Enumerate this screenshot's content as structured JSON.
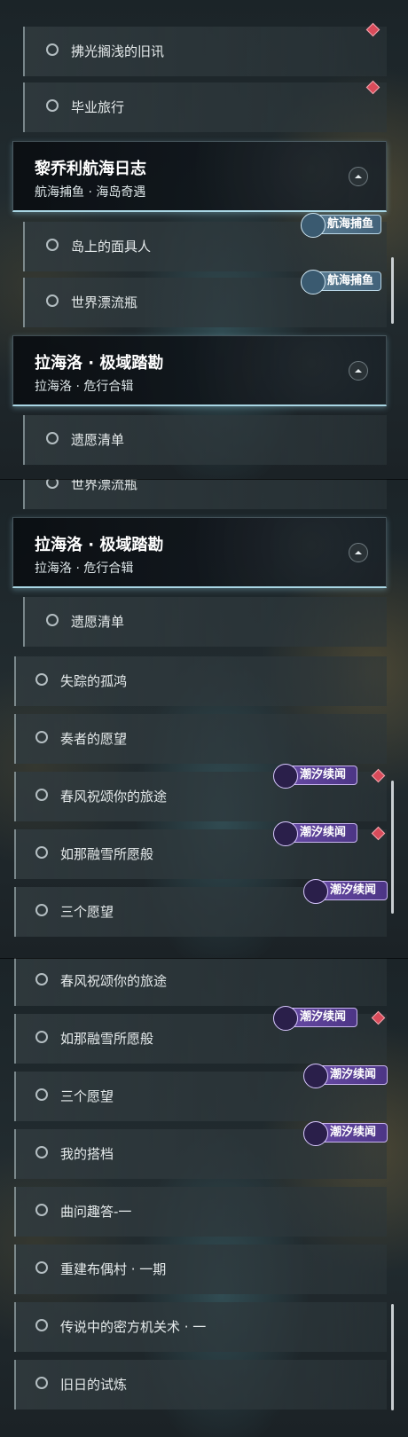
{
  "panel1": {
    "rows_top": [
      {
        "label": "拂光搁浅的旧讯",
        "flag": true
      },
      {
        "label": "毕业旅行",
        "flag": true
      }
    ],
    "group_a": {
      "title": "黎乔利航海日志",
      "subtitle": "航海捕鱼 · 海岛奇遇"
    },
    "rows_mid": [
      {
        "label": "岛上的面具人",
        "badge": "航海捕鱼"
      },
      {
        "label": "世界漂流瓶",
        "badge": "航海捕鱼"
      }
    ],
    "group_b": {
      "title": "拉海洛 · 极域踏勘",
      "subtitle": "拉海洛 · 危行合辑"
    },
    "rows_bottom": [
      {
        "label": "遗愿清单"
      }
    ]
  },
  "panel2": {
    "partial_top": "世界漂流瓶",
    "group_b": {
      "title": "拉海洛 · 极域踏勘",
      "subtitle": "拉海洛 · 危行合辑"
    },
    "sub_rows": [
      {
        "label": "遗愿清单"
      }
    ],
    "rows": [
      {
        "label": "失踪的孤鸿"
      },
      {
        "label": "奏者的愿望"
      },
      {
        "label": "春风祝颂你的旅途",
        "badge": "潮汐续闻",
        "flag": true
      },
      {
        "label": "如那融雪所愿般",
        "badge": "潮汐续闻",
        "flag": true
      },
      {
        "label": "三个愿望",
        "badge": "潮汐续闻"
      }
    ]
  },
  "panel3": {
    "rows": [
      {
        "label": "春风祝颂你的旅途"
      },
      {
        "label": "如那融雪所愿般",
        "badge": "潮汐续闻",
        "flag": true
      },
      {
        "label": "三个愿望",
        "badge": "潮汐续闻"
      },
      {
        "label": "我的搭档",
        "badge": "潮汐续闻"
      },
      {
        "label": "曲问趣答-一"
      },
      {
        "label": "重建布偶村 · 一期"
      },
      {
        "label": "传说中的密方机关术 · 一"
      },
      {
        "label": "旧日的试炼"
      }
    ]
  },
  "icons": {
    "radio": "radio-circle-icon",
    "collapse": "chevron-up-icon",
    "flag": "red-diamond-icon",
    "fish_badge": "fishing-hook-icon",
    "tide_badge": "tide-swirl-icon"
  },
  "colors": {
    "flag": "#d94b5a",
    "fish_badge": "#52748a",
    "tide_badge": "#5b3f96",
    "header_glow": "#a9d6e4"
  }
}
